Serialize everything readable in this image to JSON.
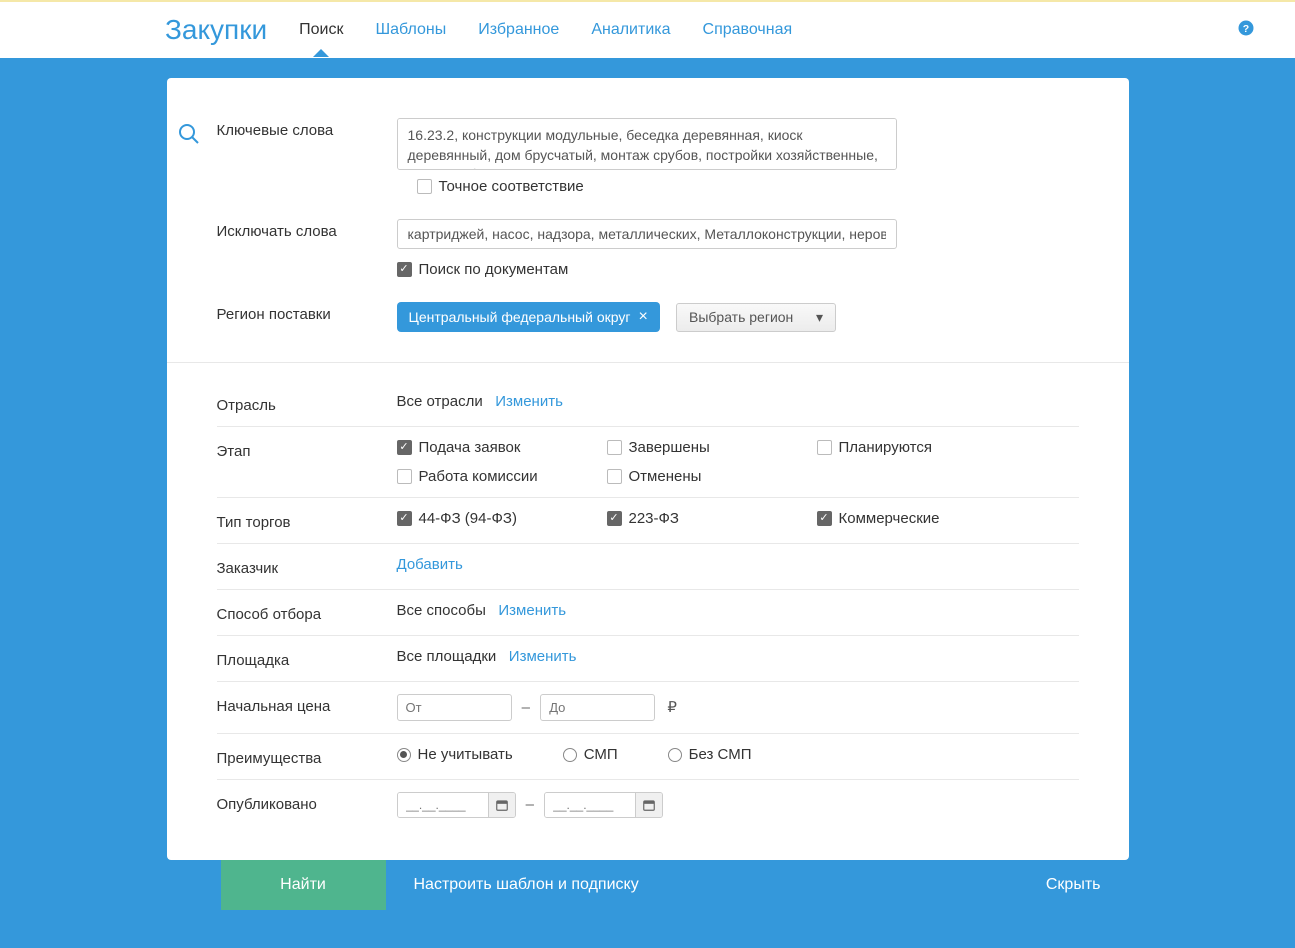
{
  "header": {
    "logo": "Закупки",
    "nav": [
      "Поиск",
      "Шаблоны",
      "Избранное",
      "Аналитика",
      "Справочная"
    ]
  },
  "search": {
    "keywords_label": "Ключевые слова",
    "keywords_value": "16.23.2, конструкции модульные, беседка деревянная, киоск деревянный, дом брусчатый, монтаж срубов, постройки хозяйственные, приусадебные,",
    "exact_match": "Точное соответствие",
    "exclude_label": "Исключать слова",
    "exclude_value": "картриджей, насос, надзора, металлических, Металлоконструкции, неровн",
    "doc_search": "Поиск по документам",
    "region_label": "Регион поставки",
    "region_tag": "Центральный федеральный округ",
    "region_select": "Выбрать регион"
  },
  "industry": {
    "label": "Отрасль",
    "value": "Все отрасли",
    "change": "Изменить"
  },
  "stage": {
    "label": "Этап",
    "options": [
      "Подача заявок",
      "Завершены",
      "Планируются",
      "Работа комиссии",
      "Отменены"
    ]
  },
  "trade_type": {
    "label": "Тип торгов",
    "options": [
      "44-ФЗ (94-ФЗ)",
      "223-ФЗ",
      "Коммерческие"
    ]
  },
  "customer": {
    "label": "Заказчик",
    "add": "Добавить"
  },
  "method": {
    "label": "Способ отбора",
    "value": "Все способы",
    "change": "Изменить"
  },
  "platform": {
    "label": "Площадка",
    "value": "Все площадки",
    "change": "Изменить"
  },
  "price": {
    "label": "Начальная цена",
    "from_ph": "От",
    "to_ph": "До",
    "currency": "₽"
  },
  "benefits": {
    "label": "Преимущества",
    "options": [
      "Не учитывать",
      "СМП",
      "Без СМП"
    ]
  },
  "published": {
    "label": "Опубликовано",
    "date_ph": "__.__.____"
  },
  "footer": {
    "find": "Найти",
    "configure": "Настроить шаблон и подписку",
    "hide": "Скрыть"
  }
}
